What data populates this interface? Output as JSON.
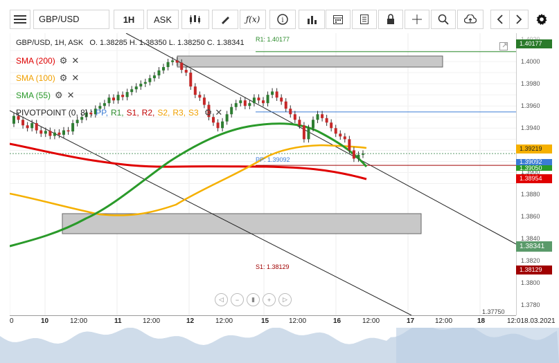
{
  "toolbar": {
    "menu_icon": "hamburger-menu-icon",
    "symbol": "GBP/USD",
    "timeframe": "1H",
    "price_type": "ASK"
  },
  "header": {
    "instrument_info": "GBP/USD, 1H, ASK   O. 1.38285 H. 1.38350 L. 1.38250 C. 1.38341"
  },
  "indicators": [
    {
      "label": "SMA (200)",
      "color": "#e00000"
    },
    {
      "label": "SMA (100)",
      "color": "#f0a000"
    },
    {
      "label": "SMA (55)",
      "color": "#2a9a2a"
    }
  ],
  "pivot": {
    "name": "PIVOTPOINT (0, 8)",
    "sep": ":",
    "items": [
      {
        "label": "PP,",
        "color": "#3a7bd5"
      },
      {
        "label": "R1,",
        "color": "#2a8a2a"
      },
      {
        "label": "S1,",
        "color": "#c00000"
      },
      {
        "label": "R2,",
        "color": "#c00000"
      },
      {
        "label": "S2,",
        "color": "#f0a000"
      },
      {
        "label": "R3,",
        "color": "#f0a000"
      },
      {
        "label": "S3",
        "color": "#f0a000"
      }
    ]
  },
  "levels": {
    "r1_label": "R1: 1.40177",
    "pp_label": "PP: 1.39092",
    "s1_label": "S1: 1.38129",
    "bottom_label": "1.37750"
  },
  "price_axis": {
    "ticks": [
      "1.4000",
      "1.3980",
      "1.3960",
      "1.3940",
      "1.3920",
      "1.3900",
      "1.3880",
      "1.3860",
      "1.3840",
      "1.3820",
      "1.3800",
      "1.3780"
    ],
    "top_partial": "1.4020"
  },
  "tags": {
    "r1": "1.40177",
    "sma100": "1.39219",
    "pp": "1.39092",
    "sma55": "1.39050",
    "sma200": "1.38954",
    "current": "1.38341",
    "s1": "1.38129"
  },
  "time_axis": {
    "labels": [
      "0",
      "10",
      "12:00",
      "11",
      "12:00",
      "12",
      "12:00",
      "15",
      "12:00",
      "16",
      "12:00",
      "17",
      "12:00",
      "18",
      "12:018.03.2021"
    ]
  },
  "colors": {
    "sma200": "#e00000",
    "sma100": "#f5b000",
    "sma55": "#2a9a2a",
    "r1": "#2a8a2a",
    "pp": "#3a7bd5",
    "s1": "#a00000",
    "current": "#5a9a6a",
    "candle_up": "#2e7d32",
    "candle_down": "#c62828"
  }
}
